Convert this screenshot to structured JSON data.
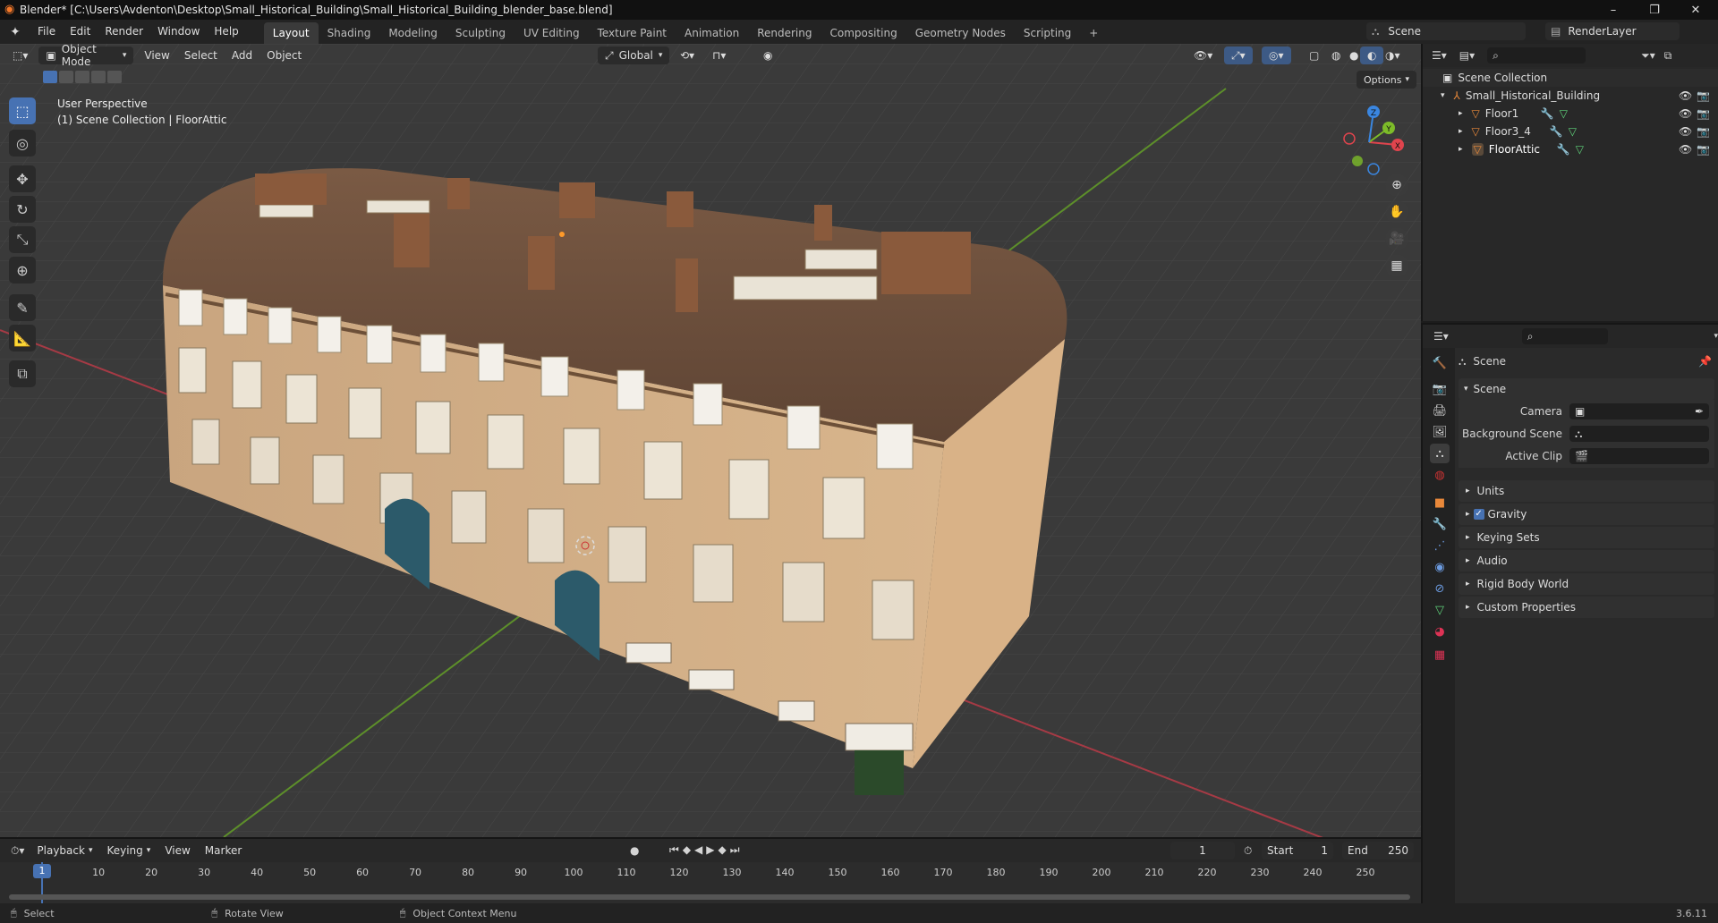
{
  "window": {
    "title": "Blender* [C:\\Users\\Avdenton\\Desktop\\Small_Historical_Building\\Small_Historical_Building_blender_base.blend]",
    "minimize": "–",
    "maximize": "❐",
    "close": "✕"
  },
  "menubar": {
    "items": [
      "File",
      "Edit",
      "Render",
      "Window",
      "Help"
    ],
    "workspaces": [
      "Layout",
      "Shading",
      "Modeling",
      "Sculpting",
      "UV Editing",
      "Texture Paint",
      "Animation",
      "Rendering",
      "Compositing",
      "Geometry Nodes",
      "Scripting"
    ],
    "active_workspace": "Layout",
    "add_workspace": "+",
    "scene": "Scene",
    "view_layer": "RenderLayer"
  },
  "viewport": {
    "mode": "Object Mode",
    "menus": [
      "View",
      "Select",
      "Add",
      "Object"
    ],
    "orientation": "Global",
    "options": "Options",
    "info_line1": "User Perspective",
    "info_line2": "(1) Scene Collection | FloorAttic",
    "gizmo": {
      "x": "X",
      "y": "Y",
      "z": "Z"
    }
  },
  "outliner": {
    "root": "Scene Collection",
    "items": [
      {
        "label": "Small_Historical_Building",
        "depth": 1
      },
      {
        "label": "Floor1",
        "depth": 2
      },
      {
        "label": "Floor3_4",
        "depth": 2
      },
      {
        "label": "FloorAttic",
        "depth": 2
      }
    ]
  },
  "properties": {
    "context": "Scene",
    "panel": "Scene",
    "fields": [
      {
        "label": "Camera",
        "value": ""
      },
      {
        "label": "Background Scene",
        "value": ""
      },
      {
        "label": "Active Clip",
        "value": ""
      }
    ],
    "sections": [
      "Units",
      "Gravity",
      "Keying Sets",
      "Audio",
      "Rigid Body World",
      "Custom Properties"
    ],
    "gravity_checked": true
  },
  "timeline": {
    "menus": [
      "Playback",
      "Keying",
      "View",
      "Marker"
    ],
    "current_frame": "1",
    "start_label": "Start",
    "start": "1",
    "end_label": "End",
    "end": "250",
    "ticks": [
      "1",
      "10",
      "20",
      "30",
      "40",
      "50",
      "60",
      "70",
      "80",
      "90",
      "100",
      "110",
      "120",
      "130",
      "140",
      "150",
      "160",
      "170",
      "180",
      "190",
      "200",
      "210",
      "220",
      "230",
      "240",
      "250"
    ]
  },
  "statusbar": {
    "hint1": "Select",
    "hint2": "Rotate View",
    "hint3": "Object Context Menu",
    "version": "3.6.11"
  },
  "colors": {
    "accent": "#4772b3",
    "x_axis": "#e0444d",
    "y_axis": "#7dbc29",
    "z_axis": "#3a86e0",
    "object_orange": "#e8883a",
    "modifier_blue": "#6c9be0",
    "mesh_green": "#5fd27a"
  }
}
